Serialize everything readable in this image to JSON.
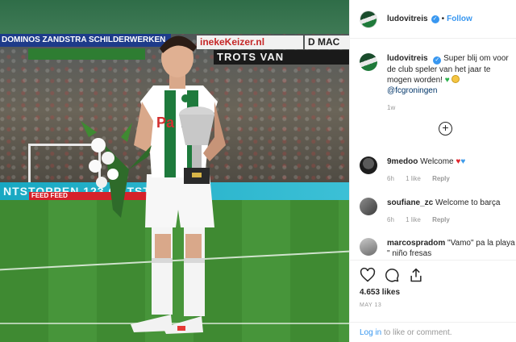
{
  "photo": {
    "banners": {
      "dominos": "DOMINOS  ZANDSTRA SCHILDERWERKEN",
      "ineke": "inekeKeizer.nl",
      "dmac": "D MAC",
      "trots": "TROTS VAN",
      "board": "NTSTOPPEN  123 ONTSTOPPEN",
      "feed": "FEED  FEED"
    },
    "jersey_sponsor": "PaN"
  },
  "header": {
    "username": "ludovitreis",
    "follow_label": "Follow",
    "separator": "•"
  },
  "caption": {
    "username": "ludovitreis",
    "text": "Super blij om voor de club speler van het jaar te mogen worden!",
    "mention": "@fcgroningen",
    "time": "1w"
  },
  "comments": [
    {
      "username": "9medoo",
      "text": "Welcome",
      "time": "6h",
      "likes": "1 like",
      "reply": "Reply"
    },
    {
      "username": "soufiane_zc",
      "text": "Welcome to barça",
      "time": "6h",
      "likes": "1 like",
      "reply": "Reply"
    },
    {
      "username": "marcospradom",
      "text": "\"Vamo\" pa la playa \" niño fresas"
    }
  ],
  "actions": {
    "likes_text": "4.653 likes",
    "date": "MAY 13"
  },
  "login": {
    "link": "Log in",
    "text": "to like or comment."
  },
  "colors": {
    "accent": "#3897f0",
    "grey_text": "#999999",
    "dark_text": "#262626"
  }
}
